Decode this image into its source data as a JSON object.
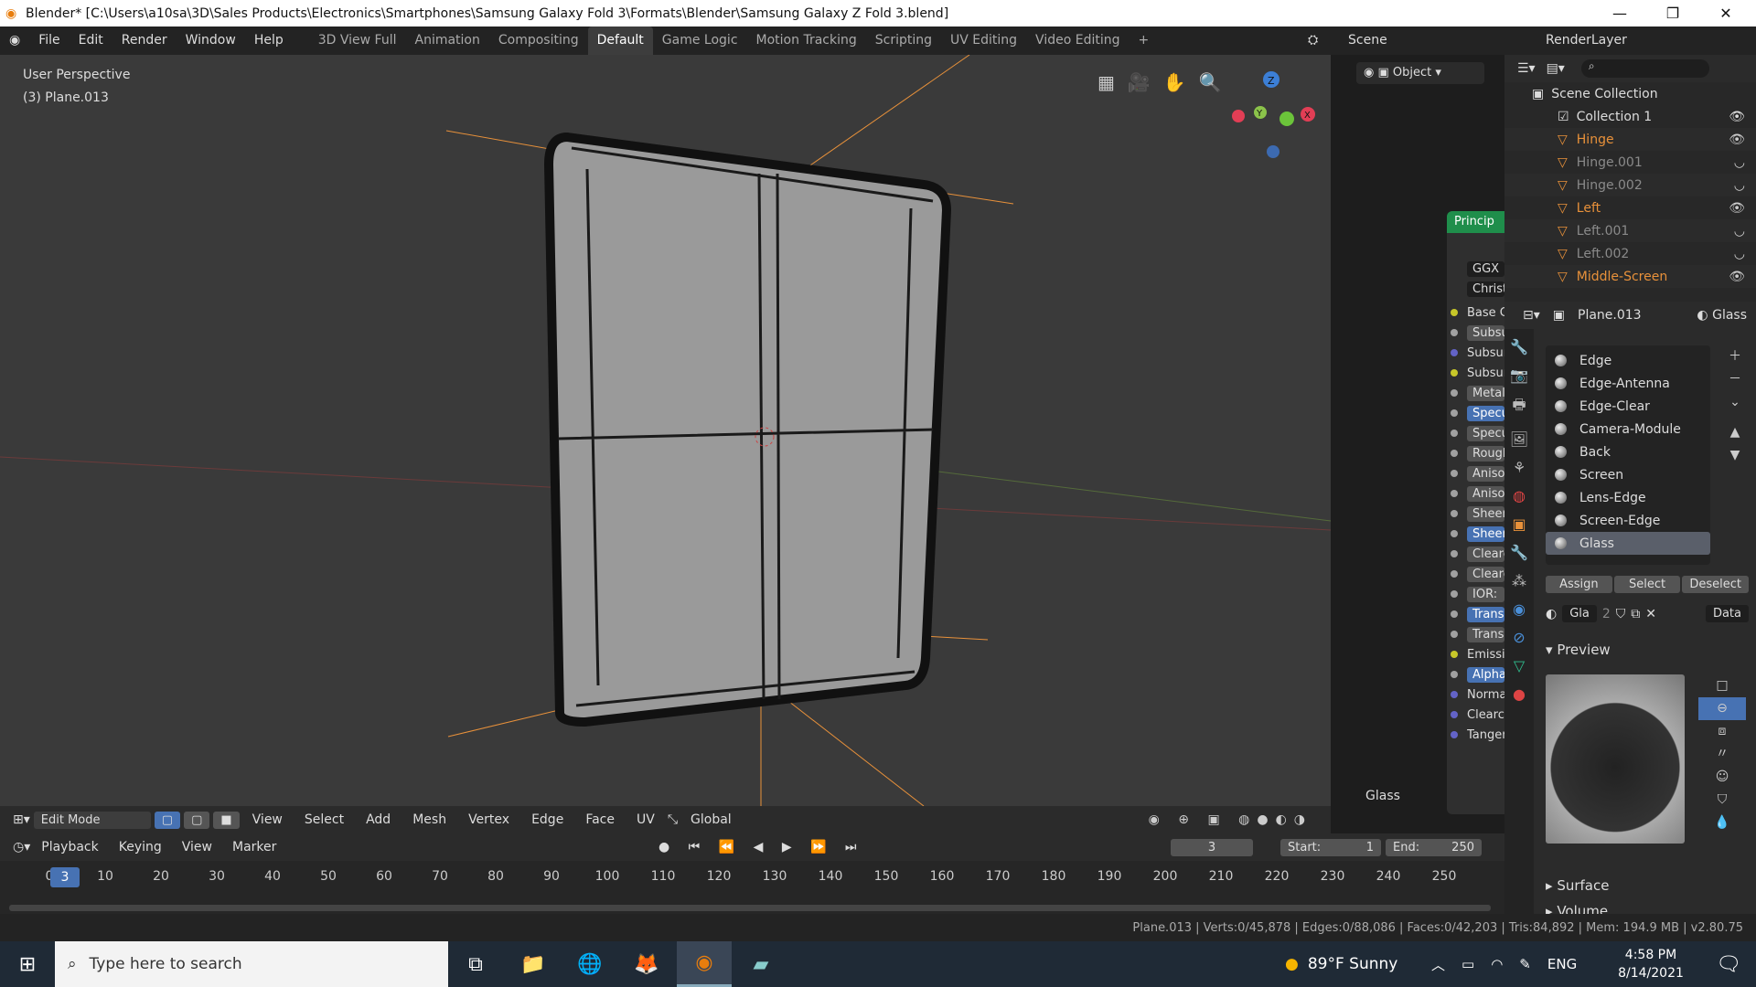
{
  "title": "Blender* [C:\\Users\\a10sa\\3D\\Sales Products\\Electronics\\Smartphones\\Samsung Galaxy Fold 3\\Formats\\Blender\\Samsung Galaxy Z Fold 3.blend]",
  "menu": [
    "File",
    "Edit",
    "Render",
    "Window",
    "Help"
  ],
  "workspaces": [
    "3D View Full",
    "Animation",
    "Compositing",
    "Default",
    "Game Logic",
    "Motion Tracking",
    "Scripting",
    "UV Editing",
    "Video Editing",
    "+"
  ],
  "active_workspace": "Default",
  "scene": "Scene",
  "render_layer": "RenderLayer",
  "viewport": {
    "view_name": "User Perspective",
    "object_label": "(3) Plane.013",
    "mode": "Edit Mode",
    "header_menus": [
      "View",
      "Select",
      "Add",
      "Mesh",
      "Vertex",
      "Edge",
      "Face",
      "UV"
    ],
    "orientation": "Global",
    "gizmo_axes": [
      "Z",
      "Y",
      "X"
    ]
  },
  "node_editor": {
    "node_title": "Princip",
    "selects": [
      "GGX",
      "Christer"
    ],
    "sockets": [
      {
        "label": "Base Co",
        "style": "plain",
        "color": "#c7c729"
      },
      {
        "label": "Subsurf",
        "style": "field",
        "color": "#a1a1a1"
      },
      {
        "label": "Subsurf",
        "style": "plain",
        "color": "#6363c7"
      },
      {
        "label": "Subsurf",
        "style": "plain",
        "color": "#c7c729"
      },
      {
        "label": "Metallic",
        "style": "field",
        "color": "#a1a1a1"
      },
      {
        "label": "Specula",
        "style": "blue",
        "color": "#a1a1a1"
      },
      {
        "label": "Specula",
        "style": "field",
        "color": "#a1a1a1"
      },
      {
        "label": "Roughn",
        "style": "field",
        "color": "#a1a1a1"
      },
      {
        "label": "Anisotr",
        "style": "field",
        "color": "#a1a1a1"
      },
      {
        "label": "Anisotr",
        "style": "field",
        "color": "#a1a1a1"
      },
      {
        "label": "Sheen:",
        "style": "field",
        "color": "#a1a1a1"
      },
      {
        "label": "Sheen T",
        "style": "blue",
        "color": "#a1a1a1"
      },
      {
        "label": "Clearco",
        "style": "field",
        "color": "#a1a1a1"
      },
      {
        "label": "Clearco",
        "style": "field",
        "color": "#a1a1a1"
      },
      {
        "label": "IOR:",
        "style": "field",
        "color": "#a1a1a1"
      },
      {
        "label": "Transm",
        "style": "blue",
        "color": "#a1a1a1"
      },
      {
        "label": "Transm",
        "style": "field",
        "color": "#a1a1a1"
      },
      {
        "label": "Emissio",
        "style": "plain",
        "color": "#c7c729"
      },
      {
        "label": "Alpha:",
        "style": "blue",
        "color": "#a1a1a1"
      },
      {
        "label": "Normal",
        "style": "plain",
        "color": "#6363c7"
      },
      {
        "label": "Clearco",
        "style": "plain",
        "color": "#6363c7"
      },
      {
        "label": "Tangent",
        "style": "plain",
        "color": "#6363c7"
      }
    ],
    "material_label": "Glass"
  },
  "outliner": {
    "root": "Scene Collection",
    "collection": "Collection 1",
    "items": [
      {
        "name": "Hinge",
        "active": true
      },
      {
        "name": "Hinge.001",
        "active": false
      },
      {
        "name": "Hinge.002",
        "active": false
      },
      {
        "name": "Left",
        "active": true
      },
      {
        "name": "Left.001",
        "active": false
      },
      {
        "name": "Left.002",
        "active": false
      },
      {
        "name": "Middle-Screen",
        "active": true
      }
    ]
  },
  "properties": {
    "object": "Plane.013",
    "material": "Glass",
    "slots": [
      "Edge",
      "Edge-Antenna",
      "Edge-Clear",
      "Camera-Module",
      "Back",
      "Screen",
      "Lens-Edge",
      "Screen-Edge",
      "Glass"
    ],
    "selected_slot": "Glass",
    "assign": "Assign",
    "select": "Select",
    "deselect": "Deselect",
    "mat_name": "Gla",
    "users": "2",
    "link": "Data",
    "sections": [
      "Preview",
      "Surface",
      "Volume"
    ]
  },
  "timeline": {
    "menus": [
      "Playback",
      "Keying",
      "View",
      "Marker"
    ],
    "current_frame": "3",
    "start_label": "Start:",
    "start": "1",
    "end_label": "End:",
    "end": "250",
    "ticks": [
      "0",
      "10",
      "20",
      "30",
      "40",
      "50",
      "60",
      "70",
      "80",
      "90",
      "100",
      "110",
      "120",
      "130",
      "140",
      "150",
      "160",
      "170",
      "180",
      "190",
      "200",
      "210",
      "220",
      "230",
      "240",
      "250"
    ]
  },
  "status": "Plane.013 | Verts:0/45,878 | Edges:0/88,086 | Faces:0/42,203 | Tris:84,892 | Mem: 194.9 MB | v2.80.75",
  "taskbar": {
    "search_placeholder": "Type here to search",
    "weather": "89°F  Sunny",
    "lang": "ENG",
    "time": "4:58 PM",
    "date": "8/14/2021"
  },
  "colors": {
    "accent": "#4772b3",
    "orange": "#e8913a",
    "header": "#2b2b2b"
  }
}
